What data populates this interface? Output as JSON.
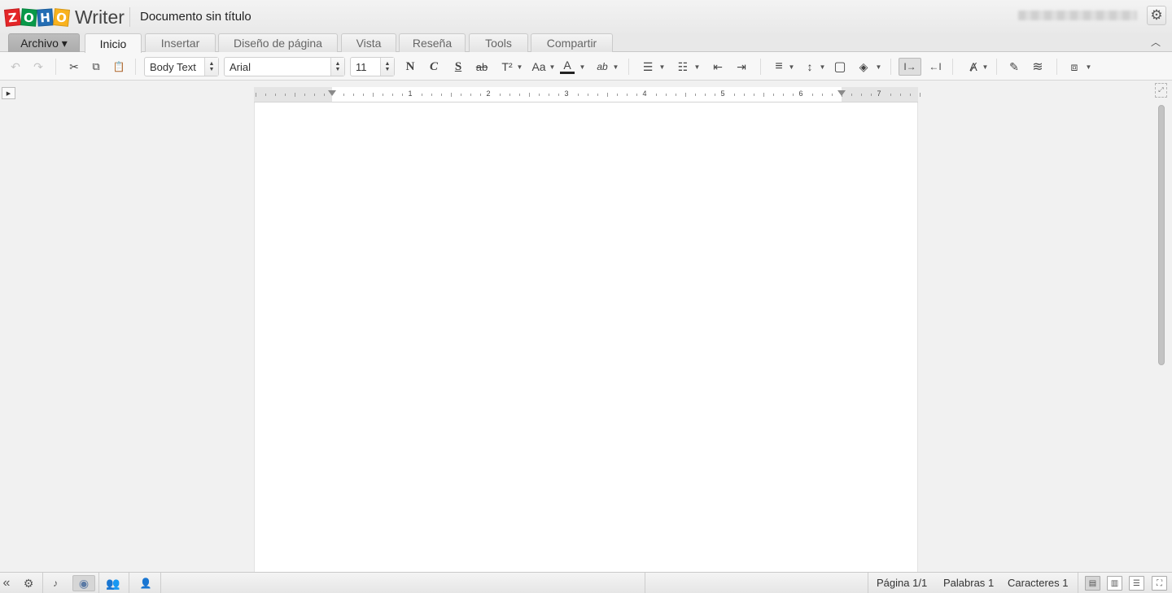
{
  "app": {
    "logo_letters": [
      "Z",
      "O",
      "H",
      "O"
    ],
    "logo_colors": [
      "#e42527",
      "#089949",
      "#226db4",
      "#f9b21d"
    ],
    "product_name": "Writer",
    "document_title": "Documento sin título"
  },
  "tabs": [
    {
      "label": "Archivo ▾",
      "type": "menu"
    },
    {
      "label": "Inicio",
      "active": true
    },
    {
      "label": "Insertar"
    },
    {
      "label": "Diseño de página"
    },
    {
      "label": "Vista"
    },
    {
      "label": "Reseña"
    },
    {
      "label": "Tools"
    },
    {
      "label": "Compartir"
    }
  ],
  "toolbar": {
    "undo_icon": "↶",
    "redo_icon": "↷",
    "cut_icon": "✂",
    "copy_icon": "⧉",
    "paste_icon": "📋",
    "style_value": "Body Text",
    "font_value": "Arial",
    "size_value": "11",
    "bold_label": "N",
    "italic_label": "C",
    "underline_label": "S",
    "strike_label": "ab",
    "superscript_label": "T²",
    "case_label": "Aa",
    "font_color_label": "A",
    "highlight_label": "ab",
    "bullets_icon": "☰",
    "numbering_icon": "☷",
    "outdent_icon": "⇤",
    "indent_icon": "⇥",
    "align_icon": "≡",
    "line_spacing_icon": "↕",
    "border_icon": "▢",
    "fill_icon": "◈",
    "ltr_icon": "I→",
    "rtl_icon": "←I",
    "clear_format_icon": "Ⱥ",
    "format_painter_icon": "✎",
    "styles_icon": "≋",
    "plugins_icon": "⧈",
    "accent_color": "#dedede"
  },
  "ruler_numbers": [
    "1",
    "2",
    "3",
    "4",
    "5",
    "6",
    "7"
  ],
  "statusbar": {
    "collapse_icon": "«",
    "bell_icon": "🔔",
    "page_label": "Página",
    "page_value": "1/1",
    "words_label": "Palabras",
    "words_value": "1",
    "chars_label": "Caracteres",
    "chars_value": "1"
  },
  "scroll_fraction": 0.56
}
